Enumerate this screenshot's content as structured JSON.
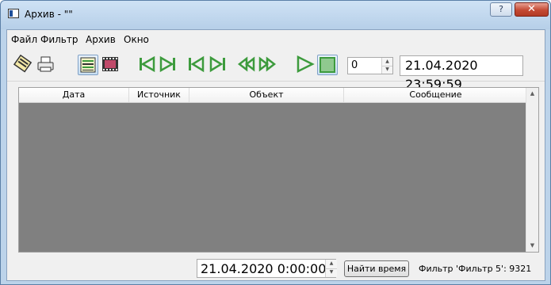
{
  "window": {
    "title": "Архив - \"\"",
    "help_label": "?",
    "close_label": "✕"
  },
  "menu": {
    "items": [
      {
        "label": "Файл"
      },
      {
        "label": "Фильтр"
      },
      {
        "label": "Архив"
      },
      {
        "label": "Окно"
      }
    ]
  },
  "toolbar": {
    "buttons": [
      "open-archive-icon",
      "print-icon",
      "list-view-icon",
      "film-view-icon",
      "skip-first-icon",
      "step-back-icon",
      "skip-prev-icon",
      "skip-next-icon",
      "rewind-icon",
      "fast-forward-icon",
      "play-icon",
      "stop-icon"
    ],
    "speed_value": "0",
    "current_datetime": "21.04.2020 23:59:59"
  },
  "grid": {
    "columns": [
      "Дата",
      "Источник",
      "Объект",
      "Сообщение"
    ]
  },
  "bottom": {
    "search_time": "21.04.2020 0:00:00",
    "find_button": "Найти время",
    "filter_status": "Фильтр 'Фильтр 5': 9321"
  },
  "colors": {
    "nav_icon": "#3d9b3d",
    "grid_background": "#808080",
    "title_bar": "#bcd3ea"
  }
}
